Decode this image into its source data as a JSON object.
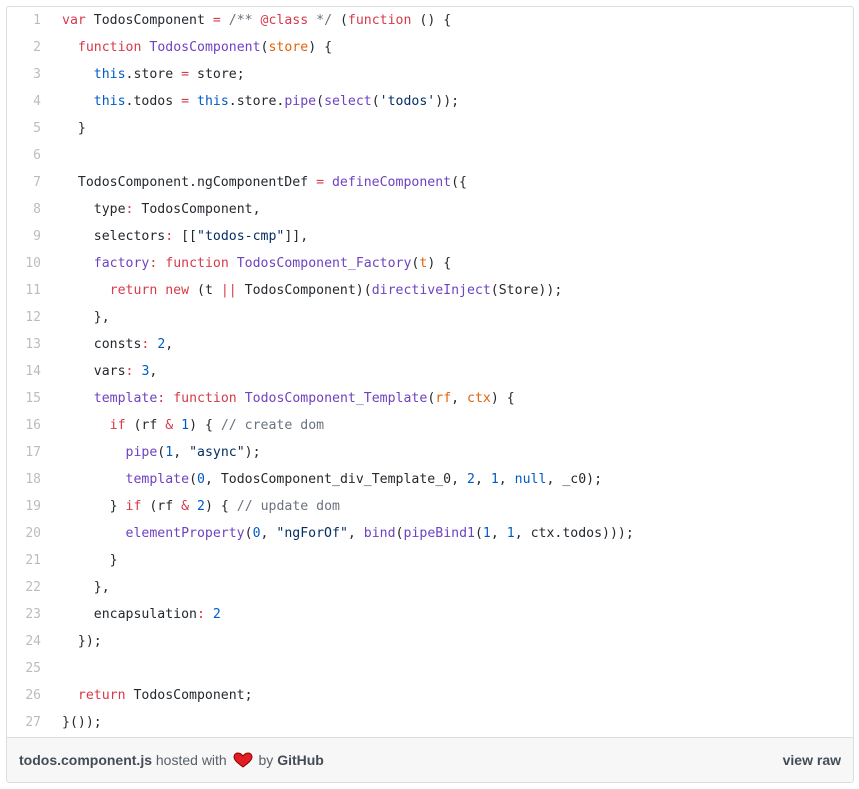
{
  "colors": {
    "keyword": "#d73a49",
    "entity": "#6f42c1",
    "comment": "#6a737d",
    "string": "#032f62",
    "constant": "#005cc5",
    "plain": "#24292e",
    "line_number": "rgba(27,31,35,0.30)",
    "heart": "#e11d21"
  },
  "code_lines": [
    {
      "n": "1",
      "tokens": [
        [
          "k",
          "var"
        ],
        [
          "p",
          " TodosComponent "
        ],
        [
          "k",
          "="
        ],
        [
          "p",
          " "
        ],
        [
          "c",
          "/** "
        ],
        [
          "k",
          "@class"
        ],
        [
          "c",
          " */"
        ],
        [
          "p",
          " ("
        ],
        [
          "k",
          "function"
        ],
        [
          "p",
          " () {"
        ]
      ]
    },
    {
      "n": "2",
      "tokens": [
        [
          "p",
          "  "
        ],
        [
          "k",
          "function"
        ],
        [
          "p",
          " "
        ],
        [
          "e",
          "TodosComponent"
        ],
        [
          "p",
          "("
        ],
        [
          "n",
          "store"
        ],
        [
          "p",
          ") {"
        ]
      ]
    },
    {
      "n": "3",
      "tokens": [
        [
          "p",
          "    "
        ],
        [
          "v",
          "this"
        ],
        [
          "p",
          "."
        ],
        [
          "p",
          "store"
        ],
        [
          "p",
          " "
        ],
        [
          "k",
          "="
        ],
        [
          "p",
          " store;"
        ]
      ]
    },
    {
      "n": "4",
      "tokens": [
        [
          "p",
          "    "
        ],
        [
          "v",
          "this"
        ],
        [
          "p",
          ".todos "
        ],
        [
          "k",
          "="
        ],
        [
          "p",
          " "
        ],
        [
          "v",
          "this"
        ],
        [
          "p",
          ".store."
        ],
        [
          "e",
          "pipe"
        ],
        [
          "p",
          "("
        ],
        [
          "e",
          "select"
        ],
        [
          "p",
          "("
        ],
        [
          "s",
          "'todos'"
        ],
        [
          "p",
          "));"
        ]
      ]
    },
    {
      "n": "5",
      "tokens": [
        [
          "p",
          "  }"
        ]
      ]
    },
    {
      "n": "6",
      "tokens": [
        [
          "p",
          ""
        ]
      ]
    },
    {
      "n": "7",
      "tokens": [
        [
          "p",
          "  TodosComponent.ngComponentDef "
        ],
        [
          "k",
          "="
        ],
        [
          "p",
          " "
        ],
        [
          "e",
          "defineComponent"
        ],
        [
          "p",
          "({"
        ]
      ]
    },
    {
      "n": "8",
      "tokens": [
        [
          "p",
          "    type"
        ],
        [
          "k",
          ":"
        ],
        [
          "p",
          " TodosComponent,"
        ]
      ]
    },
    {
      "n": "9",
      "tokens": [
        [
          "p",
          "    selectors"
        ],
        [
          "k",
          ":"
        ],
        [
          "p",
          " [["
        ],
        [
          "s",
          "\"todos-cmp\""
        ],
        [
          "p",
          "]],"
        ]
      ]
    },
    {
      "n": "10",
      "tokens": [
        [
          "p",
          "    "
        ],
        [
          "e",
          "factory"
        ],
        [
          "k",
          ":"
        ],
        [
          "p",
          " "
        ],
        [
          "k",
          "function"
        ],
        [
          "p",
          " "
        ],
        [
          "e",
          "TodosComponent_Factory"
        ],
        [
          "p",
          "("
        ],
        [
          "n",
          "t"
        ],
        [
          "p",
          ") {"
        ]
      ]
    },
    {
      "n": "11",
      "tokens": [
        [
          "p",
          "      "
        ],
        [
          "k",
          "return"
        ],
        [
          "p",
          " "
        ],
        [
          "k",
          "new"
        ],
        [
          "p",
          " (t "
        ],
        [
          "k",
          "||"
        ],
        [
          "p",
          " TodosComponent)("
        ],
        [
          "e",
          "directiveInject"
        ],
        [
          "p",
          "(Store));"
        ]
      ]
    },
    {
      "n": "12",
      "tokens": [
        [
          "p",
          "    },"
        ]
      ]
    },
    {
      "n": "13",
      "tokens": [
        [
          "p",
          "    consts"
        ],
        [
          "k",
          ":"
        ],
        [
          "p",
          " "
        ],
        [
          "v",
          "2"
        ],
        [
          "p",
          ","
        ]
      ]
    },
    {
      "n": "14",
      "tokens": [
        [
          "p",
          "    vars"
        ],
        [
          "k",
          ":"
        ],
        [
          "p",
          " "
        ],
        [
          "v",
          "3"
        ],
        [
          "p",
          ","
        ]
      ]
    },
    {
      "n": "15",
      "tokens": [
        [
          "p",
          "    "
        ],
        [
          "e",
          "template"
        ],
        [
          "k",
          ":"
        ],
        [
          "p",
          " "
        ],
        [
          "k",
          "function"
        ],
        [
          "p",
          " "
        ],
        [
          "e",
          "TodosComponent_Template"
        ],
        [
          "p",
          "("
        ],
        [
          "n",
          "rf"
        ],
        [
          "p",
          ", "
        ],
        [
          "n",
          "ctx"
        ],
        [
          "p",
          ") {"
        ]
      ]
    },
    {
      "n": "16",
      "tokens": [
        [
          "p",
          "      "
        ],
        [
          "k",
          "if"
        ],
        [
          "p",
          " (rf "
        ],
        [
          "k",
          "&"
        ],
        [
          "p",
          " "
        ],
        [
          "v",
          "1"
        ],
        [
          "p",
          ") { "
        ],
        [
          "c",
          "// create dom"
        ]
      ]
    },
    {
      "n": "17",
      "tokens": [
        [
          "p",
          "        "
        ],
        [
          "e",
          "pipe"
        ],
        [
          "p",
          "("
        ],
        [
          "v",
          "1"
        ],
        [
          "p",
          ", "
        ],
        [
          "s",
          "\"async\""
        ],
        [
          "p",
          ");"
        ]
      ]
    },
    {
      "n": "18",
      "tokens": [
        [
          "p",
          "        "
        ],
        [
          "e",
          "template"
        ],
        [
          "p",
          "("
        ],
        [
          "v",
          "0"
        ],
        [
          "p",
          ", TodosComponent_div_Template_0, "
        ],
        [
          "v",
          "2"
        ],
        [
          "p",
          ", "
        ],
        [
          "v",
          "1"
        ],
        [
          "p",
          ", "
        ],
        [
          "v",
          "null"
        ],
        [
          "p",
          ", _c0);"
        ]
      ]
    },
    {
      "n": "19",
      "tokens": [
        [
          "p",
          "      } "
        ],
        [
          "k",
          "if"
        ],
        [
          "p",
          " (rf "
        ],
        [
          "k",
          "&"
        ],
        [
          "p",
          " "
        ],
        [
          "v",
          "2"
        ],
        [
          "p",
          ") { "
        ],
        [
          "c",
          "// update dom"
        ]
      ]
    },
    {
      "n": "20",
      "tokens": [
        [
          "p",
          "        "
        ],
        [
          "e",
          "elementProperty"
        ],
        [
          "p",
          "("
        ],
        [
          "v",
          "0"
        ],
        [
          "p",
          ", "
        ],
        [
          "s",
          "\"ngForOf\""
        ],
        [
          "p",
          ", "
        ],
        [
          "e",
          "bind"
        ],
        [
          "p",
          "("
        ],
        [
          "e",
          "pipeBind1"
        ],
        [
          "p",
          "("
        ],
        [
          "v",
          "1"
        ],
        [
          "p",
          ", "
        ],
        [
          "v",
          "1"
        ],
        [
          "p",
          ", ctx.todos)));"
        ]
      ]
    },
    {
      "n": "21",
      "tokens": [
        [
          "p",
          "      }"
        ]
      ]
    },
    {
      "n": "22",
      "tokens": [
        [
          "p",
          "    },"
        ]
      ]
    },
    {
      "n": "23",
      "tokens": [
        [
          "p",
          "    encapsulation"
        ],
        [
          "k",
          ":"
        ],
        [
          "p",
          " "
        ],
        [
          "v",
          "2"
        ]
      ]
    },
    {
      "n": "24",
      "tokens": [
        [
          "p",
          "  });"
        ]
      ]
    },
    {
      "n": "25",
      "tokens": [
        [
          "p",
          ""
        ]
      ]
    },
    {
      "n": "26",
      "tokens": [
        [
          "p",
          "  "
        ],
        [
          "k",
          "return"
        ],
        [
          "p",
          " TodosComponent;"
        ]
      ]
    },
    {
      "n": "27",
      "tokens": [
        [
          "p",
          "}());"
        ]
      ]
    }
  ],
  "footer": {
    "file_name": "todos.component.js",
    "hosted_with": "hosted with",
    "heart_icon": "heart-icon",
    "by": "by",
    "host": "GitHub",
    "view_raw": "view raw"
  }
}
